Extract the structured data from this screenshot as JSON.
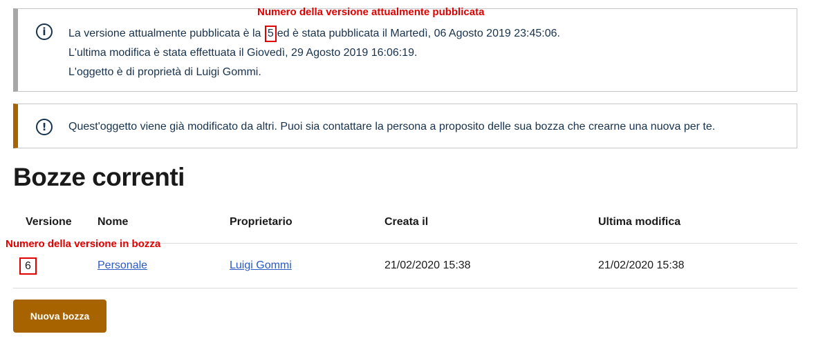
{
  "info_callout": {
    "line1_before": "La versione attualmente pubblicata è la",
    "published_version": "5",
    "line1_after": "ed è stata pubblicata il Martedì, 06 Agosto 2019 23:45:06.",
    "line2": "L'ultima modifica è stata effettuata il Giovedì, 29 Agosto 2019 16:06:19.",
    "line3": "L'oggetto è di proprietà di Luigi Gommi.",
    "icon": "info-icon"
  },
  "warning_callout": {
    "text": "Quest'oggetto viene già modificato da altri. Puoi sia contattare la persona a proposito delle sua bozza che crearne una nuova per te.",
    "icon": "warning-icon"
  },
  "annotations": {
    "published": "Numero della versione attualmente pubblicata",
    "draft": "Numero della versione in bozza"
  },
  "section_title": "Bozze correnti",
  "table": {
    "headers": [
      "Versione",
      "Nome",
      "Proprietario",
      "Creata il",
      "Ultima modifica"
    ],
    "rows": [
      {
        "version": "6",
        "name": "Personale",
        "owner": "Luigi Gommi",
        "created": "21/02/2020 15:38",
        "modified": "21/02/2020 15:38"
      }
    ]
  },
  "new_draft_button": "Nuova bozza",
  "colors": {
    "accent": "#a66300",
    "annotation": "#e00000",
    "link": "#2b59c3",
    "text": "#17324d"
  }
}
